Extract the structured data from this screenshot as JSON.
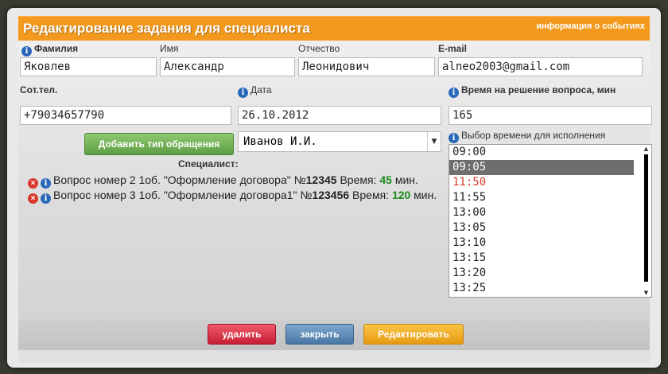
{
  "title": "Редактирование задания для специалиста",
  "title_link": "информация о событиях",
  "fields": {
    "lastname": {
      "label": "Фамилия",
      "value": "Яковлев"
    },
    "firstname": {
      "label": "Имя",
      "value": "Александр"
    },
    "patronymic": {
      "label": "Отчество",
      "value": "Леонидович"
    },
    "email": {
      "label": "E-mail",
      "value": "alneo2003@gmail.com"
    },
    "phone": {
      "label": "Сот.тел.",
      "value": "+79034657790"
    },
    "date": {
      "label": "Дата",
      "value": "26.10.2012"
    },
    "duration": {
      "label": "Время на решение вопроса, мин",
      "value": "165"
    }
  },
  "add_type_button": "Добавить тип обращения",
  "specialist_select": "Иванов И.И.",
  "specialist_label": "Специалист:",
  "time_label": "Выбор времени для исполнения",
  "tasks": [
    {
      "prefix": "Вопрос номер 2 1об. \"Оформление договора\" №",
      "number": "12345",
      "time_label": " Время: ",
      "minutes": "45",
      "suffix": " мин."
    },
    {
      "prefix": "Вопрос номер 3 1об. \"Оформление договора1\" №",
      "number": "123456",
      "time_label": " Время: ",
      "minutes": "120",
      "suffix": " мин."
    }
  ],
  "times": [
    "09:00",
    "09:05",
    "11:50",
    "11:55",
    "13:00",
    "13:05",
    "13:10",
    "13:15",
    "13:20",
    "13:25"
  ],
  "selected_time": "09:05",
  "busy_time": "11:50",
  "buttons": {
    "delete": "удалить",
    "close": "закрыть",
    "edit": "Редактировать"
  }
}
